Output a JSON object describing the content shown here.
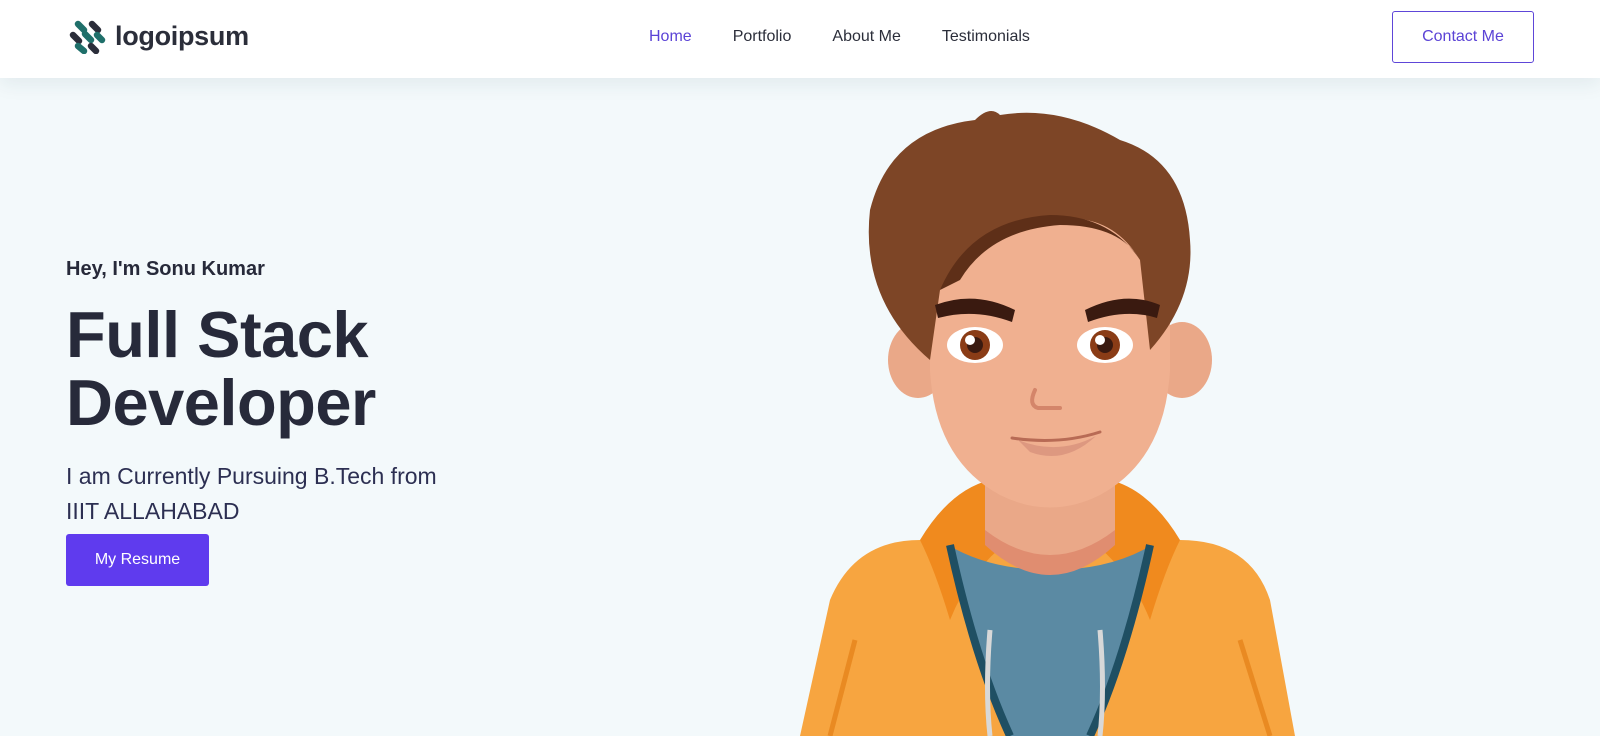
{
  "header": {
    "logo_text": "logoipsum",
    "logo_icon": "logo-mark-icon",
    "nav": [
      {
        "label": "Home",
        "active": true
      },
      {
        "label": "Portfolio",
        "active": false
      },
      {
        "label": "About Me",
        "active": false
      },
      {
        "label": "Testimonials",
        "active": false
      }
    ],
    "contact_label": "Contact Me"
  },
  "hero": {
    "greeting": "Hey, I'm Sonu Kumar",
    "title_line1": "Full Stack",
    "title_line2": "Developer",
    "subtitle": "I am Currently Pursuing B.Tech from IIIT ALLAHABAD",
    "resume_label": "My Resume",
    "illustration": "cartoon-developer-avatar"
  },
  "colors": {
    "accent": "#5f3bee",
    "nav_active": "#5b43d6",
    "background": "#f3f9fb",
    "text": "#272a3a",
    "logo": "#1f6f6a"
  }
}
